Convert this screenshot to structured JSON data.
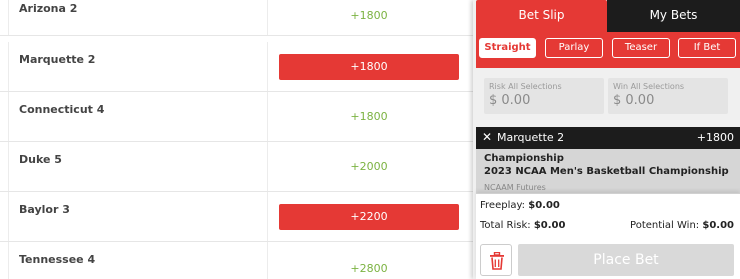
{
  "odds": {
    "rows": [
      {
        "team": "Arizona 2",
        "price": "+1800",
        "selected": false
      },
      {
        "team": "Marquette 2",
        "price": "+1800",
        "selected": true
      },
      {
        "team": "Connecticut 4",
        "price": "+1800",
        "selected": false
      },
      {
        "team": "Duke 5",
        "price": "+2000",
        "selected": false
      },
      {
        "team": "Baylor 3",
        "price": "+2200",
        "selected": true
      },
      {
        "team": "Tennessee 4",
        "price": "+2800",
        "selected": false
      }
    ]
  },
  "betslip": {
    "tabs": [
      "Bet Slip",
      "My Bets"
    ],
    "active_tab": "Bet Slip",
    "bet_types": [
      "Straight",
      "Parlay",
      "Teaser",
      "If Bet"
    ],
    "active_bet_type": "Straight",
    "risk_label": "Risk All Selections",
    "risk_value": "$ 0.00",
    "win_label": "Win All Selections",
    "win_value": "$ 0.00",
    "selection": {
      "close": "✕",
      "team": "Marquette 2",
      "odds": "+1800",
      "market": "Championship",
      "event": "2023 NCAA Men's Basketball Championship",
      "league": "NCAAM Futures"
    },
    "freeplay_label": "Freeplay:",
    "freeplay_value": "$0.00",
    "total_risk_label": "Total Risk:",
    "total_risk_value": "$0.00",
    "potential_win_label": "Potential Win:",
    "potential_win_value": "$0.00",
    "place_bet": "Place Bet"
  },
  "colors": {
    "accent_red": "#e53935",
    "odds_green": "#7cb342",
    "dark_tab": "#1c1c1c"
  },
  "icons": {
    "remove_selection": "close-icon",
    "clear_slip": "trash-icon"
  }
}
